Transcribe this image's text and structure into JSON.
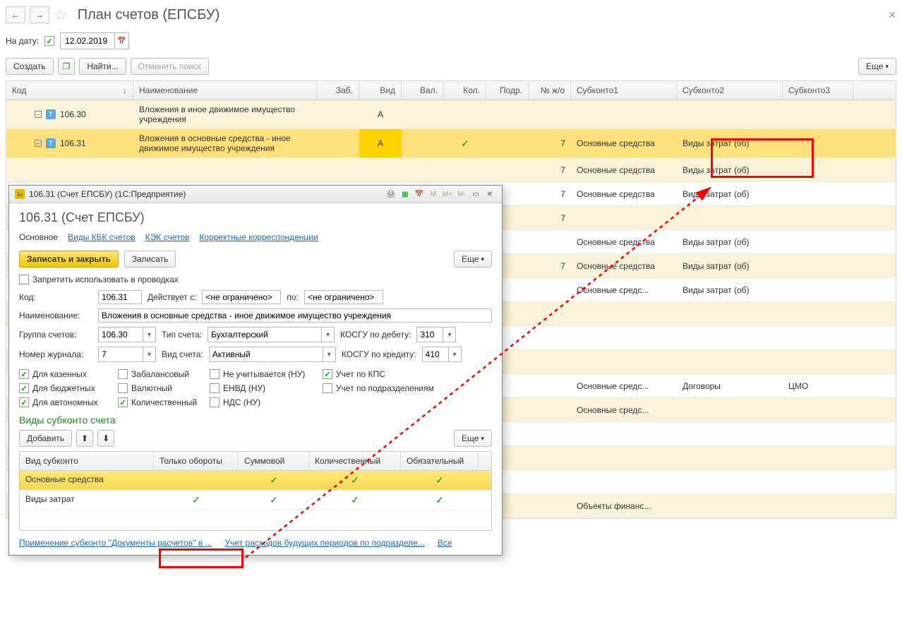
{
  "header": {
    "title": "План счетов (ЕПСБУ)"
  },
  "date": {
    "label": "На дату:",
    "value": "12.02.2019"
  },
  "toolbar": {
    "create": "Создать",
    "find": "Найти...",
    "cancel_find": "Отменить поиск",
    "more": "Еще"
  },
  "grid_headers": {
    "code": "Код",
    "name": "Наименование",
    "zab": "Заб.",
    "vid": "Вид",
    "val": "Вал.",
    "kol": "Кол.",
    "podr": "Подр.",
    "num": "№ ж/о",
    "sub1": "Субконто1",
    "sub2": "Субконто2",
    "sub3": "Субконто3"
  },
  "rows": [
    {
      "exp": "−",
      "code": "106.30",
      "name": "Вложения в иное движимое имущество учреждения",
      "vid": "А"
    },
    {
      "exp": "+",
      "code": "106.31",
      "name": "Вложения в основные средства - иное движимое имущество учреждения",
      "vid": "А",
      "kol": "✓",
      "num": "7",
      "sub1": "Основные средства",
      "sub2": "Виды затрат (об)",
      "sel": true
    },
    {
      "num": "7",
      "sub1": "Основные средства",
      "sub2": "Виды затрат (об)"
    },
    {
      "num": "7",
      "sub1": "Основные средства",
      "sub2": "Виды затрат (об)"
    },
    {
      "num": "7"
    },
    {
      "sub1": "Основные средства",
      "sub2": "Виды затрат (об)"
    },
    {
      "num": "7",
      "sub1": "Основные средства",
      "sub2": "Виды затрат (об)"
    },
    {
      "sub1": "Основные средс...",
      "sub2": "Виды затрат (об)"
    },
    {},
    {
      "kol": "✓"
    },
    {},
    {
      "sub1": "Основные средс...",
      "sub2": "Договоры",
      "sub3": "ЦМО"
    },
    {
      "sub1": "Основные средс..."
    },
    {},
    {},
    {},
    {
      "sub1": "Объекты финанс..."
    }
  ],
  "modal": {
    "wintitle": "106.31 (Счет ЕПСБУ)  (1С:Предприятие)",
    "title": "106.31 (Счет ЕПСБУ)",
    "tabs": {
      "main": "Основное",
      "kbk": "Виды КБК счетов",
      "kek": "КЭК счетов",
      "korr": "Корректные корреспонденции"
    },
    "actions": {
      "save_close": "Записать и закрыть",
      "save": "Записать",
      "more": "Еще"
    },
    "forbid": "Запретить использовать в проводках",
    "fields": {
      "code_lbl": "Код:",
      "code": "106.31",
      "from_lbl": "Действует с:",
      "from": "<не ограничено>",
      "to_lbl": "по:",
      "to": "<не ограничено>",
      "name_lbl": "Наименование:",
      "name": "Вложения в основные средства - иное движимое имущество учреждения",
      "group_lbl": "Группа счетов:",
      "group": "106.30",
      "type_lbl": "Тип счета:",
      "type": "Бухгалтерский",
      "kosgu_d_lbl": "КОСГУ по дебету:",
      "kosgu_d": "310",
      "num_lbl": "Номер журнала:",
      "num": "7",
      "vid_lbl": "Вид счета:",
      "vid": "Активный",
      "kosgu_k_lbl": "КОСГУ по кредиту:",
      "kosgu_k": "410"
    },
    "checks": {
      "kaz": "Для казенных",
      "zab": "Забалансовый",
      "neuch": "Не учитывается (НУ)",
      "kps": "Учет по КПС",
      "budg": "Для бюджетных",
      "val": "Валютный",
      "envd": "ЕНВД (НУ)",
      "podr": "Учет по подразделениям",
      "avt": "Для автономных",
      "kol": "Количественный",
      "nds": "НДС (НУ)"
    },
    "subkonto": {
      "header": "Виды субконто счета",
      "add": "Добавить",
      "more": "Еще",
      "cols": {
        "vid": "Вид субконто",
        "obor": "Только обороты",
        "summ": "Суммовой",
        "kol": "Количественный",
        "obyaz": "Обязательный"
      },
      "rows": [
        {
          "vid": "Основные средства",
          "obor": "",
          "summ": "✓",
          "kol": "✓",
          "obyaz": "✓",
          "sel": true
        },
        {
          "vid": "Виды затрат",
          "obor": "✓",
          "summ": "✓",
          "kol": "✓",
          "obyaz": "✓"
        }
      ]
    },
    "links": {
      "l1": "Применение субконто \"Документы расчетов\" в ...",
      "l2": "Учет расходов будущих периодов по подразделе...",
      "all": "Все"
    }
  }
}
